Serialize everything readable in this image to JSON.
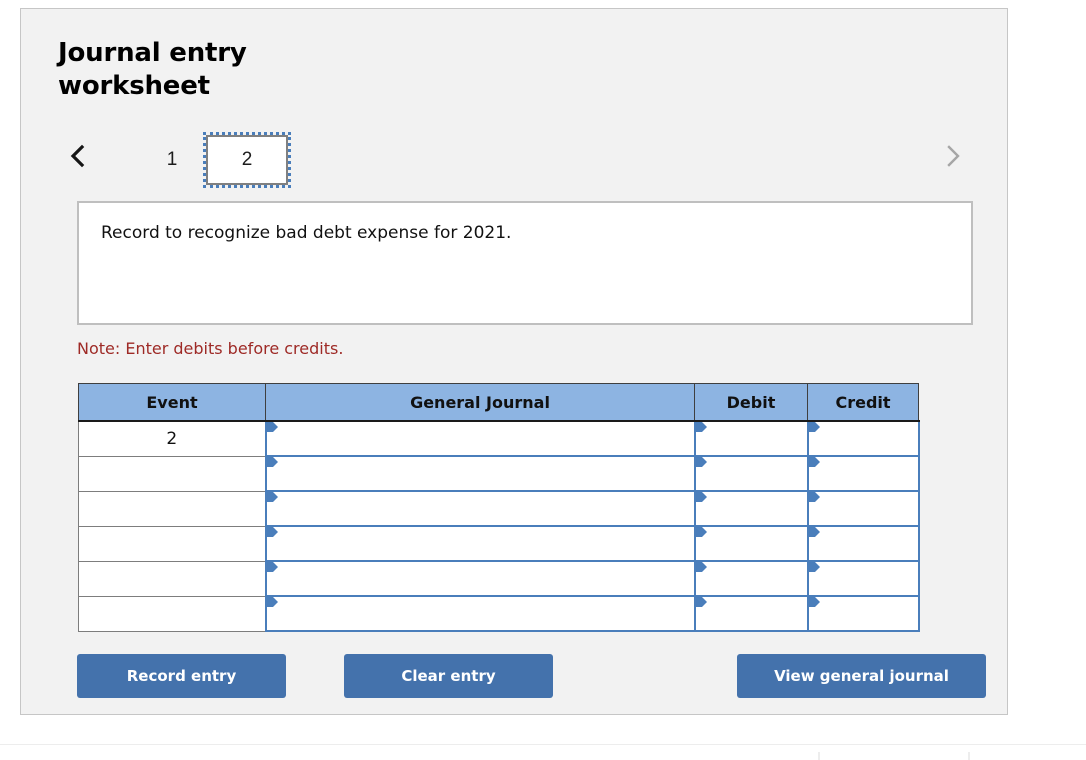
{
  "panel": {
    "title": "Journal entry worksheet"
  },
  "pager": {
    "prev_label": "previous",
    "next_label": "next",
    "tabs": [
      {
        "label": "1",
        "active": false
      },
      {
        "label": "2",
        "active": true
      }
    ]
  },
  "description": {
    "text": "Record to recognize bad debt expense for 2021."
  },
  "note": {
    "text": "Note: Enter debits before credits."
  },
  "table": {
    "headers": [
      "Event",
      "General Journal",
      "Debit",
      "Credit"
    ],
    "rows": [
      {
        "event": "2",
        "general_journal": "",
        "debit": "",
        "credit": ""
      },
      {
        "event": "",
        "general_journal": "",
        "debit": "",
        "credit": ""
      },
      {
        "event": "",
        "general_journal": "",
        "debit": "",
        "credit": ""
      },
      {
        "event": "",
        "general_journal": "",
        "debit": "",
        "credit": ""
      },
      {
        "event": "",
        "general_journal": "",
        "debit": "",
        "credit": ""
      },
      {
        "event": "",
        "general_journal": "",
        "debit": "",
        "credit": ""
      }
    ]
  },
  "actions": {
    "record_label": "Record entry",
    "clear_label": "Clear entry",
    "view_label": "View general journal"
  },
  "colors": {
    "panel_bg": "#f2f2f2",
    "header_blue": "#8db4e2",
    "button_blue": "#4472ac",
    "note_red": "#9e2a26",
    "input_border_blue": "#4a7ebb"
  }
}
